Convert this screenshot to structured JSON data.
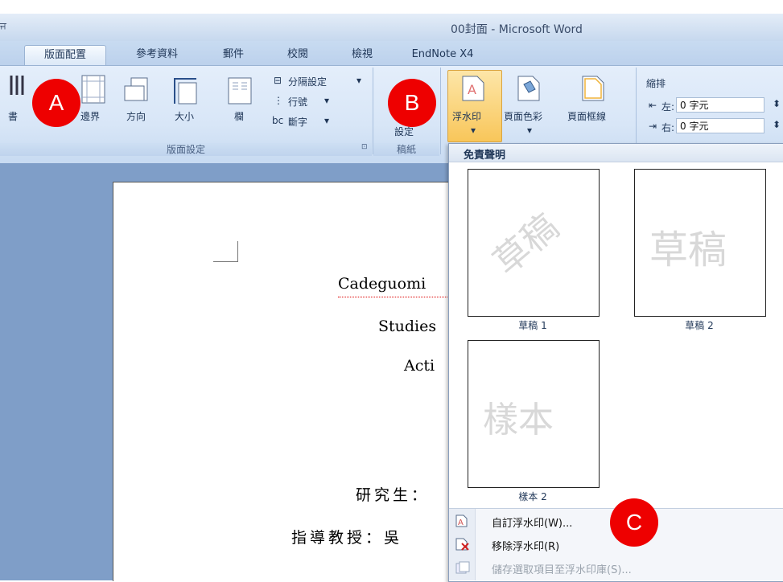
{
  "window": {
    "title": "00封面 - Microsoft Word",
    "app_tick": "ਜ"
  },
  "tabs": [
    {
      "label": "版面配置",
      "active": true
    },
    {
      "label": "參考資料"
    },
    {
      "label": "郵件"
    },
    {
      "label": "校閱"
    },
    {
      "label": "檢視"
    },
    {
      "label": "EndNote X4"
    }
  ],
  "ribbon": {
    "page_setup": {
      "group_label": "版面設定",
      "buttons": {
        "text_direction": "書",
        "margins": "邊界",
        "orientation": "方向",
        "size": "大小",
        "columns": "欄"
      },
      "breaks": "分隔設定",
      "line_numbers": "行號",
      "hyphenation": "斷字"
    },
    "manuscript": {
      "group_label": "稿紙",
      "button_label": "設定"
    },
    "page_background": {
      "watermark": "浮水印",
      "page_color": "頁面色彩",
      "page_borders": "頁面框線"
    },
    "paragraph": {
      "indent_label": "縮排",
      "left_label": "左:",
      "left_value": "0 字元",
      "right_label": "右:",
      "right_value": "0 字元"
    }
  },
  "document": {
    "lines": [
      "Cadeguomi",
      "Studies",
      "Acti",
      "研究生：",
      "指導教授：吳"
    ]
  },
  "watermark_gallery": {
    "header": "免責聲明",
    "items": [
      {
        "caption": "草稿 1",
        "watermark_text": "草稿",
        "style": "diagonal"
      },
      {
        "caption": "草稿 2",
        "watermark_text": "草稿",
        "style": "horizontal"
      },
      {
        "caption": "樣本 2",
        "watermark_text": "樣本",
        "style": "horizontal"
      }
    ],
    "menu": {
      "custom": "自訂浮水印(W)...",
      "remove": "移除浮水印(R)",
      "save": "儲存選取項目至浮水印庫(S)..."
    }
  },
  "markers": {
    "a": "A",
    "b": "B",
    "c": "C"
  },
  "colors": {
    "marker": "#ee0000",
    "ribbon": "#d8e6f7",
    "doc_background": "#7f9ec8"
  }
}
